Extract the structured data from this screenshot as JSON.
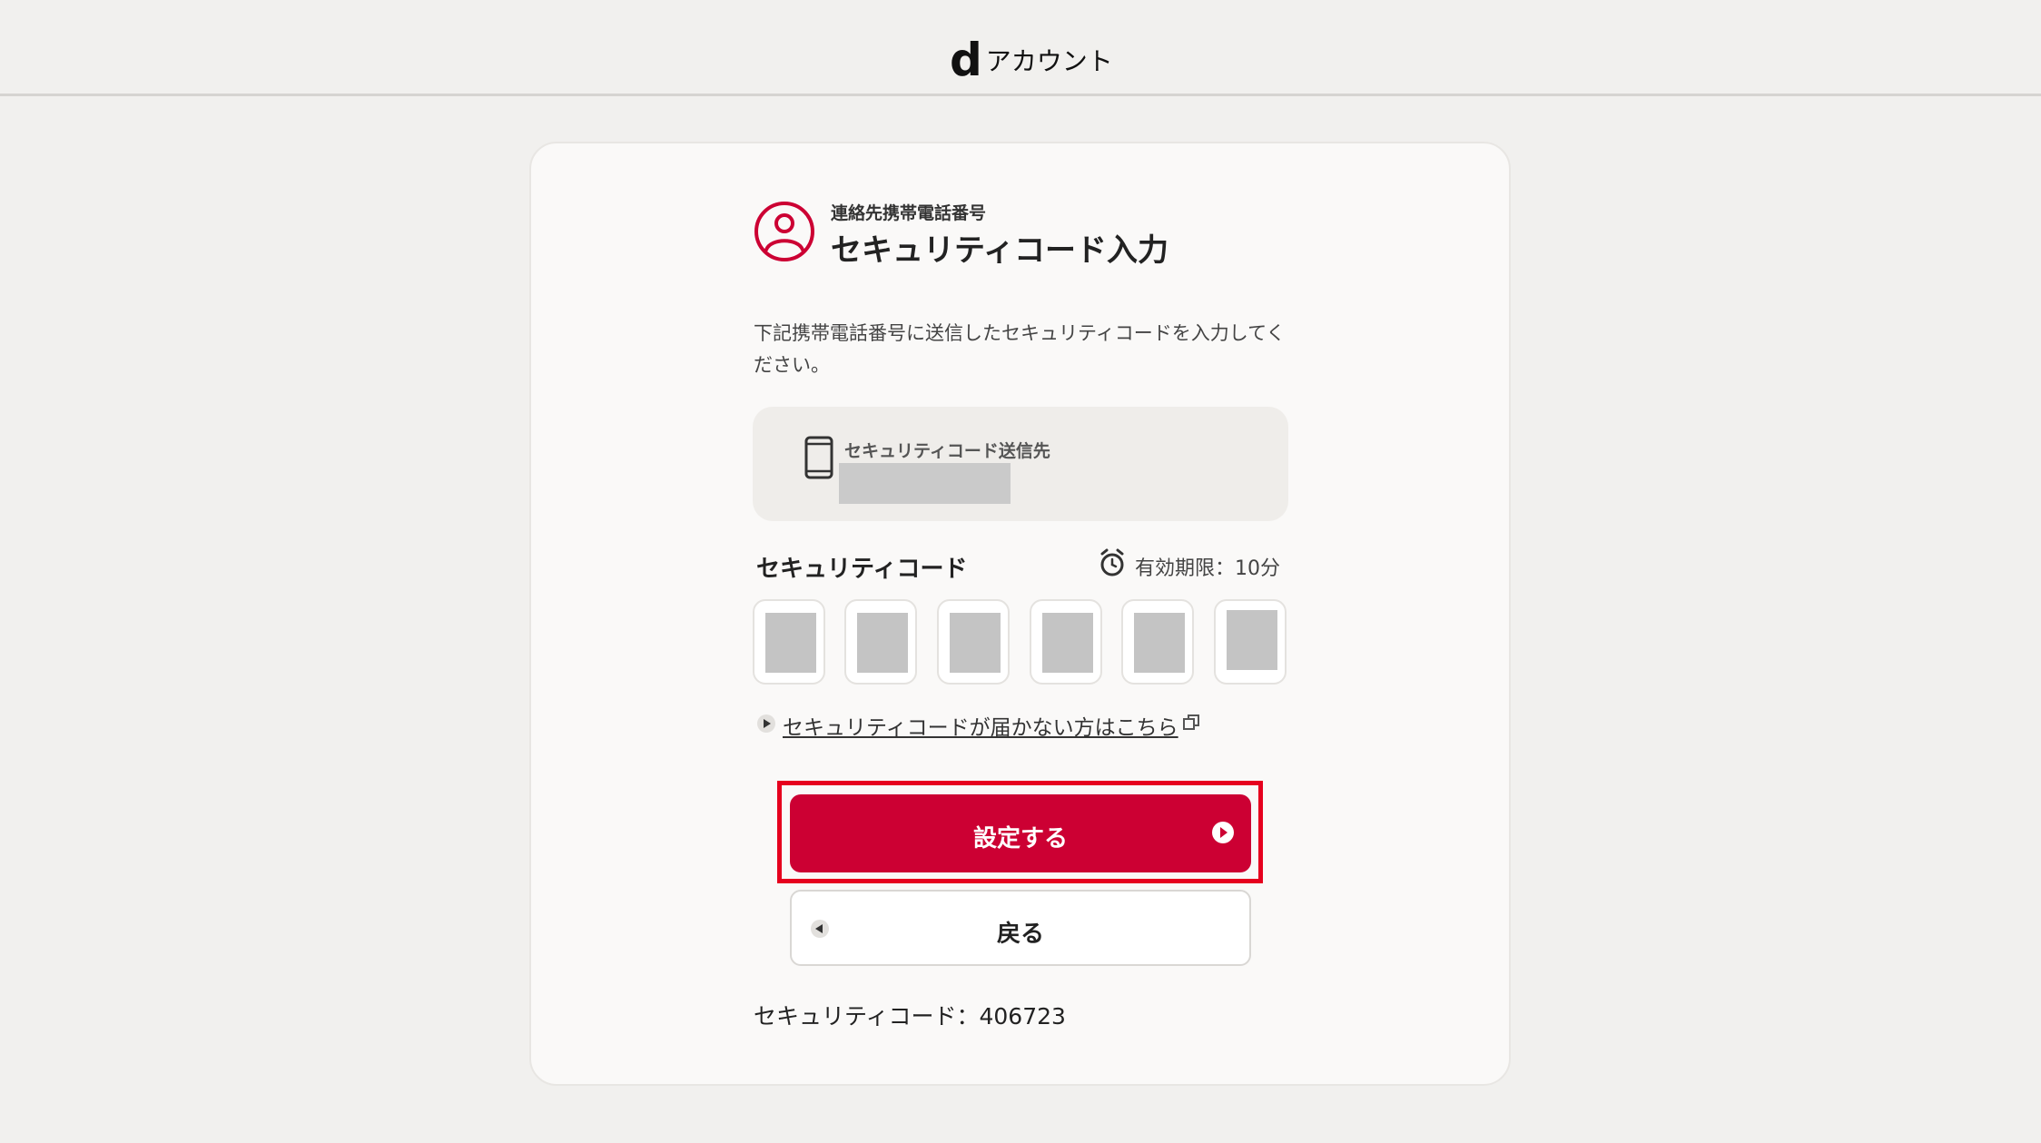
{
  "header": {
    "logo_mark": "d",
    "logo_text": "アカウント"
  },
  "card": {
    "subtitle": "連絡先携帯電話番号",
    "title": "セキュリティコード入力",
    "description": "下記携帯電話番号に送信したセキュリティコードを入力してください。",
    "destination": {
      "label": "セキュリティコード送信先",
      "icon": "smartphone-icon"
    },
    "code": {
      "label": "セキュリティコード",
      "expiry": "有効期限：10分",
      "digit_count": 6
    },
    "help_link": "セキュリティコードが届かない方はこちら",
    "submit_label": "設定する",
    "back_label": "戻る",
    "code_hint": "セキュリティコード：406723"
  },
  "colors": {
    "accent": "#cc0033",
    "highlight": "#e6001e",
    "background": "#f1f0ee",
    "card": "#faf9f8"
  }
}
